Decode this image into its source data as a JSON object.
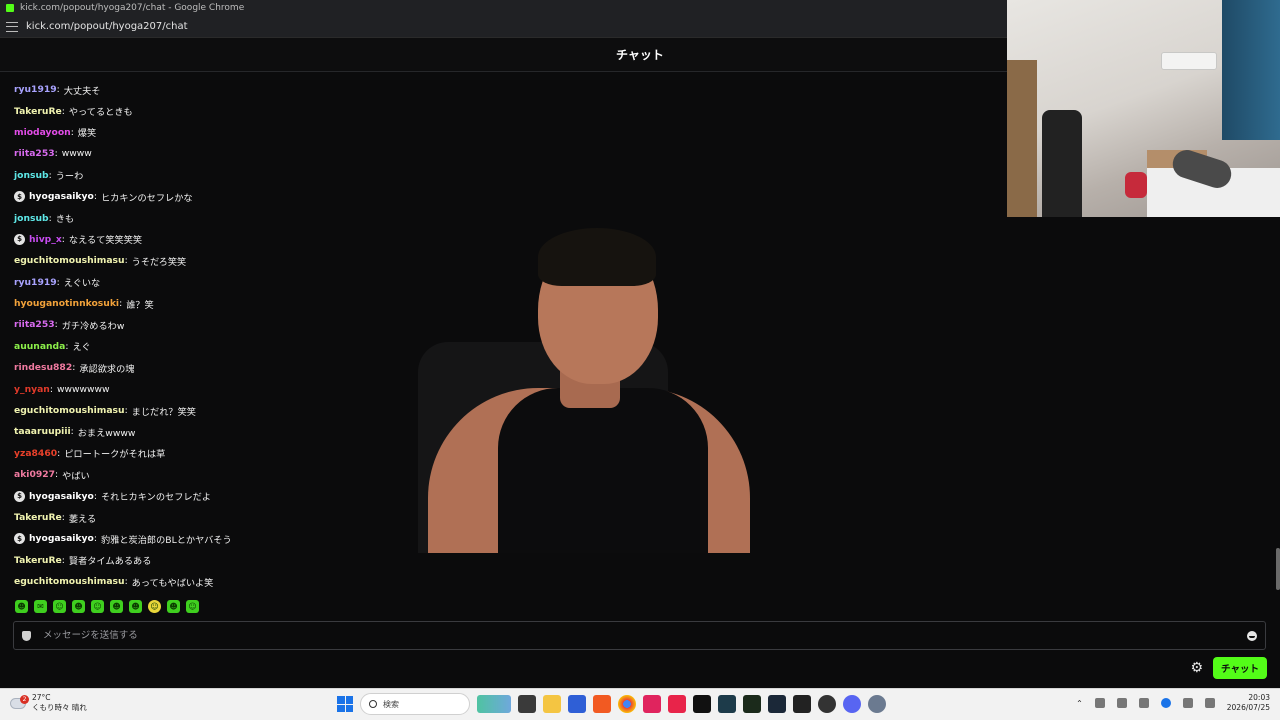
{
  "browser": {
    "window_title": "kick.com/popout/hyoga207/chat - Google Chrome",
    "url": "kick.com/popout/hyoga207/chat"
  },
  "chat": {
    "header_title": "チャット",
    "messages": [
      {
        "user": "ryu1919",
        "color": "#a9a3ff",
        "text": "大丈夫そ",
        "badge": false
      },
      {
        "user": "TakeruRe",
        "color": "#f0f3b0",
        "text": "やってるときも",
        "badge": false
      },
      {
        "user": "miodayoon",
        "color": "#e24ce8",
        "text": "爆笑",
        "badge": false
      },
      {
        "user": "riita253",
        "color": "#d96bf0",
        "text": "wwww",
        "badge": false
      },
      {
        "user": "jonsub",
        "color": "#5ee8e8",
        "text": "うーわ",
        "badge": false
      },
      {
        "user": "hyogasaikyo",
        "color": "#ffffff",
        "text": "ヒカキンのセフレかな",
        "badge": true
      },
      {
        "user": "jonsub",
        "color": "#5ee8e8",
        "text": "きも",
        "badge": false
      },
      {
        "user": "hivp_x",
        "color": "#c74cf0",
        "text": "なえるて笑笑笑笑",
        "badge": true
      },
      {
        "user": "eguchitomoushimasu",
        "color": "#f0f3b0",
        "text": "うそだろ笑笑",
        "badge": false
      },
      {
        "user": "ryu1919",
        "color": "#a9a3ff",
        "text": "えぐいな",
        "badge": false
      },
      {
        "user": "hyouganotinnkosuki",
        "color": "#f2a23a",
        "text": "誰？笑",
        "badge": false
      },
      {
        "user": "riita253",
        "color": "#d96bf0",
        "text": "ガチ冷めるわw",
        "badge": false
      },
      {
        "user": "auunanda",
        "color": "#8cf04a",
        "text": "えぐ",
        "badge": false
      },
      {
        "user": "rindesu882",
        "color": "#f07aa0",
        "text": "承認欲求の塊",
        "badge": false
      },
      {
        "user": "y_nyan",
        "color": "#e03a2a",
        "text": "wwwwwww",
        "badge": false
      },
      {
        "user": "eguchitomoushimasu",
        "color": "#f0f3b0",
        "text": "まじだれ？笑笑",
        "badge": false
      },
      {
        "user": "taaaruupiii",
        "color": "#f0f3b0",
        "text": "おまえwwww",
        "badge": false
      },
      {
        "user": "yza8460",
        "color": "#e8402a",
        "text": "ピロートークがそれは草",
        "badge": false
      },
      {
        "user": "aki0927",
        "color": "#f07aa0",
        "text": "やばい",
        "badge": false
      },
      {
        "user": "hyogasaikyo",
        "color": "#ffffff",
        "text": "それヒカキンのセフレだよ",
        "badge": true
      },
      {
        "user": "TakeruRe",
        "color": "#f0f3b0",
        "text": "萎える",
        "badge": false
      },
      {
        "user": "hyogasaikyo",
        "color": "#ffffff",
        "text": "豹雅と炭治郎のBLとかヤバそう",
        "badge": true
      },
      {
        "user": "TakeruRe",
        "color": "#f0f3b0",
        "text": "賢者タイムあるある",
        "badge": false
      },
      {
        "user": "eguchitomoushimasu",
        "color": "#f0f3b0",
        "text": "あってもやばいよ笑",
        "badge": false
      }
    ],
    "input_placeholder": "メッセージを送信する",
    "send_label": "チャット",
    "accent_color": "#53fc18"
  },
  "taskbar": {
    "temperature": "27°C",
    "weather_desc": "くもり時々 晴れ",
    "weather_alert_count": "2",
    "search_placeholder": "検索",
    "time": "20:03",
    "date": "2026/07/25"
  }
}
